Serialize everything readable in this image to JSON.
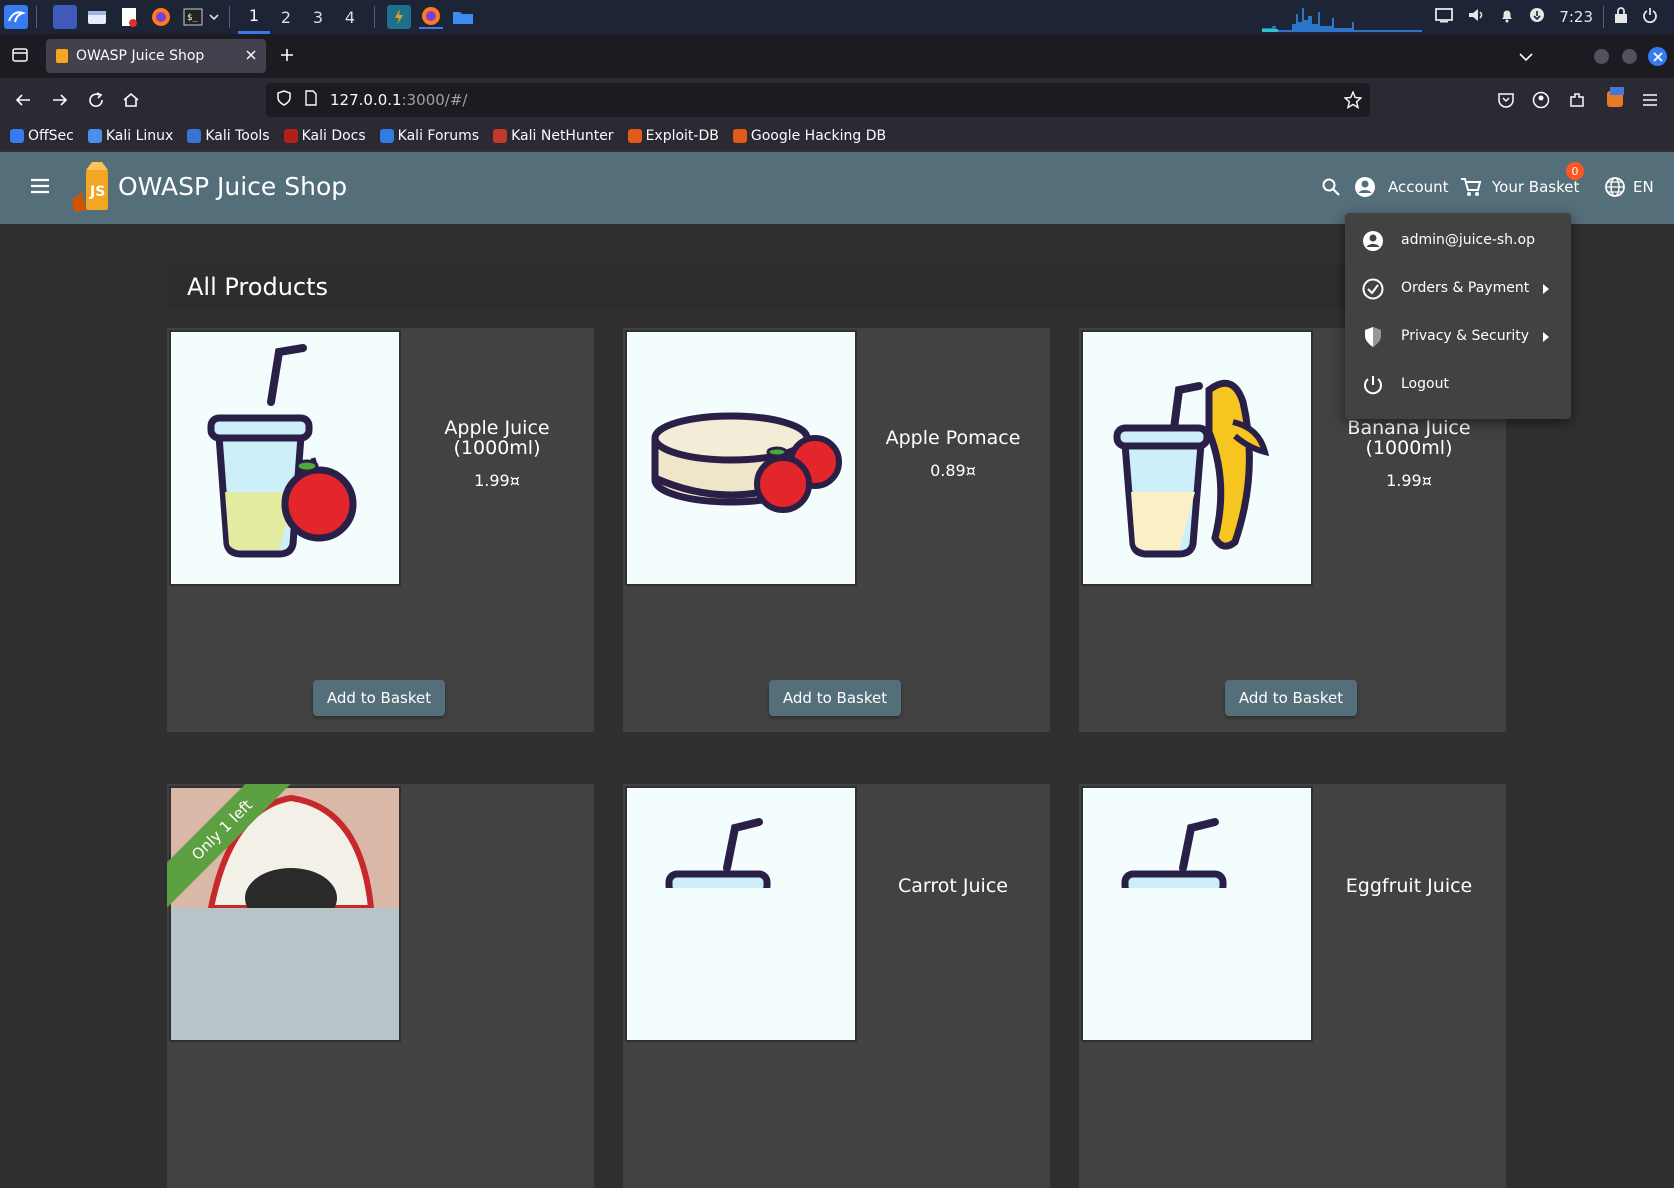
{
  "taskbar": {
    "workspaces": [
      "1",
      "2",
      "3",
      "4"
    ],
    "clock": "7:23"
  },
  "browser": {
    "tab_title": "OWASP Juice Shop",
    "url_host": "127.0.0.1",
    "url_rest": ":3000/#/",
    "bookmarks": [
      "OffSec",
      "Kali Linux",
      "Kali Tools",
      "Kali Docs",
      "Kali Forums",
      "Kali NetHunter",
      "Exploit-DB",
      "Google Hacking DB"
    ],
    "bookmark_colors": [
      "#367bf0",
      "#4b8ef0",
      "#3b72d6",
      "#b3201b",
      "#2f7de1",
      "#c23a2b",
      "#e35b1a",
      "#e35b1a"
    ]
  },
  "app": {
    "title": "OWASP Juice Shop",
    "account_label": "Account",
    "basket_label": "Your Basket",
    "basket_count": "0",
    "language": "EN",
    "page_heading": "All Products",
    "add_to_basket": "Add to Basket",
    "accent_color": "#546e7a",
    "badge_color": "#ff5722"
  },
  "products": [
    {
      "name": "Apple Juice (1000ml)",
      "price": "1.99¤"
    },
    {
      "name": "Apple Pomace",
      "price": "0.89¤"
    },
    {
      "name": "Banana Juice (1000ml)",
      "price": "1.99¤"
    },
    {
      "name": "Carrot Juice",
      "price": ""
    },
    {
      "name": "Eggfruit Juice",
      "price": ""
    }
  ],
  "ribbon": "Only 1 left",
  "menu": {
    "email": "admin@juice-sh.op",
    "orders": "Orders & Payment",
    "privacy": "Privacy & Security",
    "logout": "Logout"
  }
}
